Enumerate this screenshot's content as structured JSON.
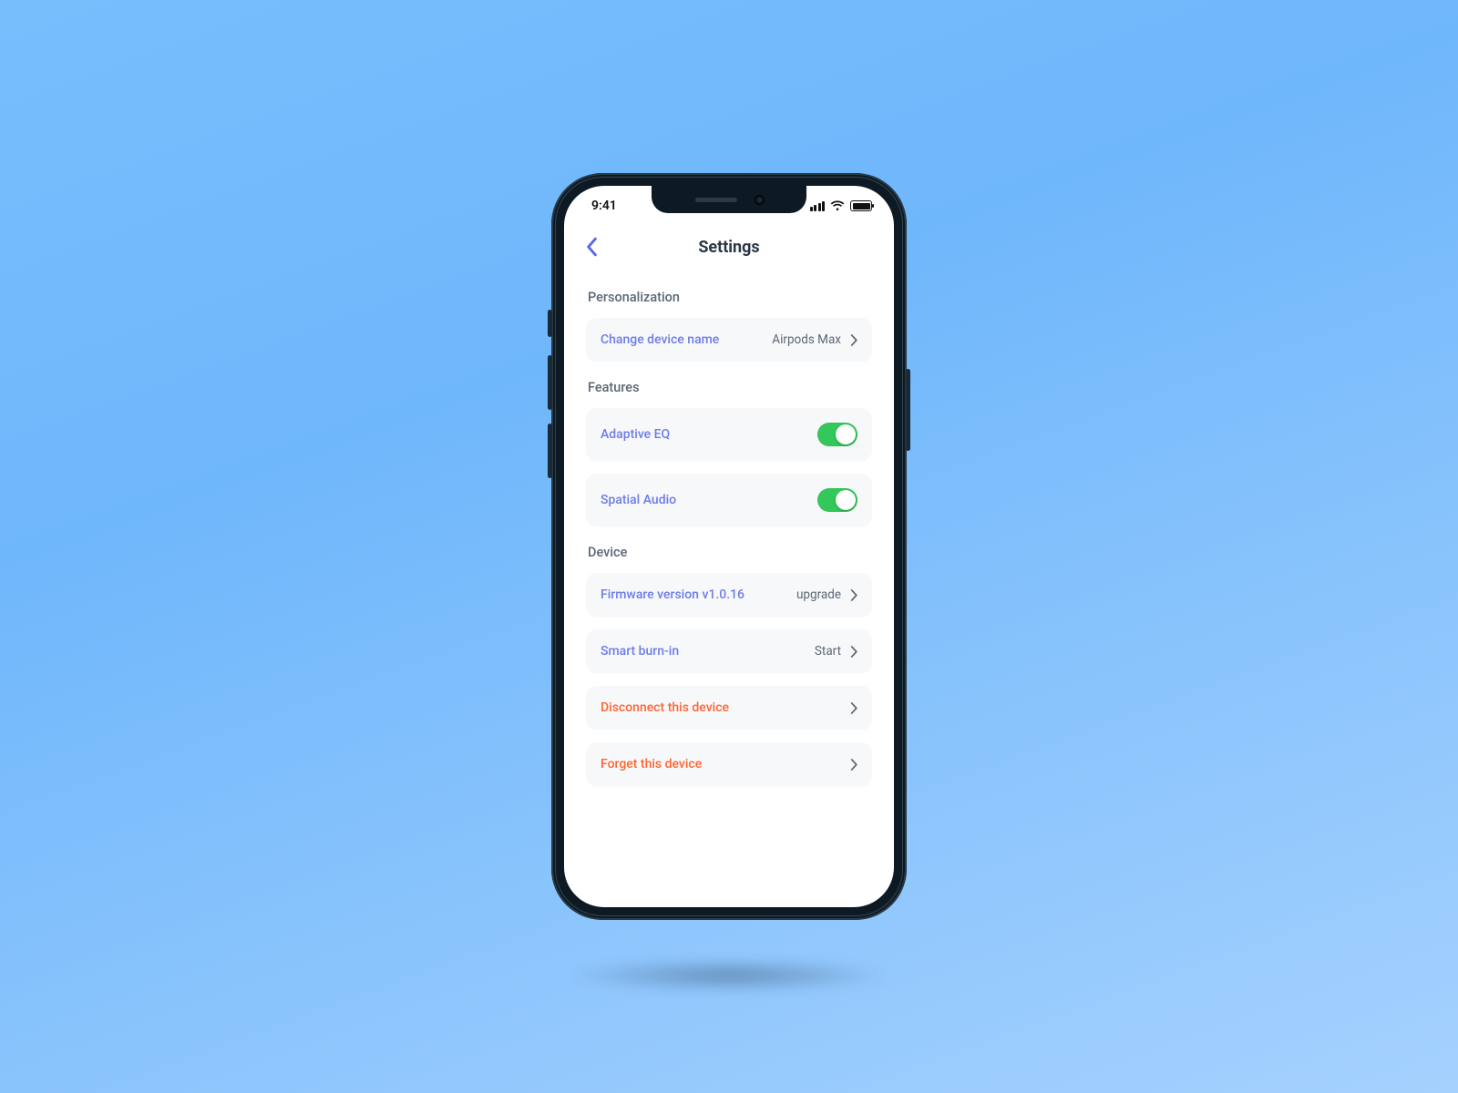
{
  "status": {
    "time": "9:41"
  },
  "nav": {
    "title": "Settings"
  },
  "sections": {
    "personalization": {
      "title": "Personalization",
      "change_name": {
        "label": "Change device name",
        "value": "Airpods Max"
      }
    },
    "features": {
      "title": "Features",
      "adaptive_eq": {
        "label": "Adaptive EQ",
        "on": true
      },
      "spatial_audio": {
        "label": "Spatial Audio",
        "on": true
      }
    },
    "device": {
      "title": "Device",
      "firmware": {
        "label": "Firmware version v1.0.16",
        "value": "upgrade"
      },
      "burn_in": {
        "label": "Smart burn-in",
        "value": "Start"
      },
      "disconnect": {
        "label": "Disconnect this device"
      },
      "forget": {
        "label": "Forget this device"
      }
    }
  }
}
